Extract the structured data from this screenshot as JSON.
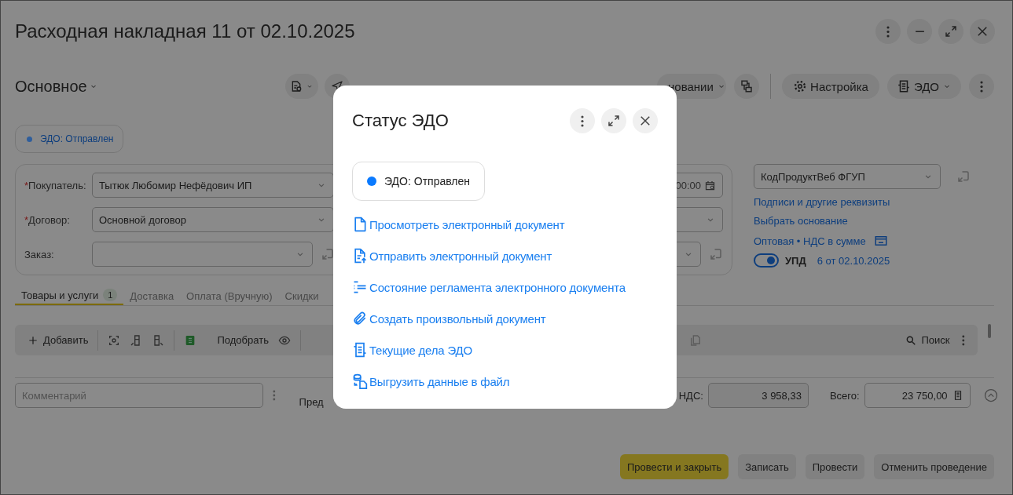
{
  "window": {
    "title": "Расходная накладная 11 от 02.10.2025"
  },
  "toolbar": {
    "section": "Основное",
    "create_based": "новании",
    "settings": "Настройка",
    "edo": "ЭДО"
  },
  "edo_status": {
    "label": "ЭДО: Отправлен",
    "color": "#2f5e9c"
  },
  "form": {
    "rows": [
      {
        "kind": "select",
        "required_mark": "*",
        "label": "Покупатель:",
        "value": "Тытюк Любомир Нефёдович ИП",
        "right": {
          "kind": "date",
          "value": "00:00"
        }
      },
      {
        "kind": "select",
        "required_mark": "*",
        "label": "Договор:",
        "value": "Основной договор",
        "right": {
          "kind": "select"
        }
      },
      {
        "kind": "select-link",
        "label": "Заказ:",
        "right": {
          "kind": "select-link"
        }
      }
    ]
  },
  "right_panel": {
    "organization": "КодПродуктВеб ФГУП",
    "links": [
      "Подписи и другие реквизиты",
      "Выбрать основание",
      "Оптовая • НДС в сумме"
    ],
    "upd": {
      "on": true,
      "label": "УПД",
      "link": "6 от 02.10.2025"
    }
  },
  "tabs": [
    {
      "label": "Товары и услуги",
      "count": "1",
      "selected": true
    },
    {
      "label": "Доставка",
      "selected": false
    },
    {
      "label": "Оплата (Вручную)",
      "selected": false
    },
    {
      "label": "Скидки",
      "selected": false
    }
  ],
  "table_toolbar": {
    "add": "Добавить",
    "pick": "Подобрать",
    "search": "Поиск"
  },
  "footer": {
    "comment_placeholder": "Комментарий",
    "partial_label": "Пред",
    "vat_label": "НДС:",
    "vat": "3 958,33",
    "total_label": "Всего:",
    "total": "23 750,00"
  },
  "actions": [
    {
      "label": "Провести и закрыть",
      "primary": true
    },
    {
      "label": "Записать",
      "primary": false
    },
    {
      "label": "Провести",
      "primary": false
    },
    {
      "label": "Отменить проведение",
      "primary": false
    }
  ],
  "dialog": {
    "title": "Статус ЭДО",
    "status": {
      "label": "ЭДО: Отправлен",
      "color": "#0a7aff"
    },
    "actions": [
      {
        "kind": "view",
        "label": "Просмотреть электронный документ"
      },
      {
        "kind": "send",
        "label": "Отправить электронный документ"
      },
      {
        "kind": "state",
        "label": "Состояние регламента электронного документа"
      },
      {
        "kind": "attach",
        "label": "Создать произвольный документ"
      },
      {
        "kind": "tasks",
        "label": "Текущие дела ЭДО"
      },
      {
        "kind": "export",
        "label": "Выгрузить данные в файл"
      }
    ]
  }
}
